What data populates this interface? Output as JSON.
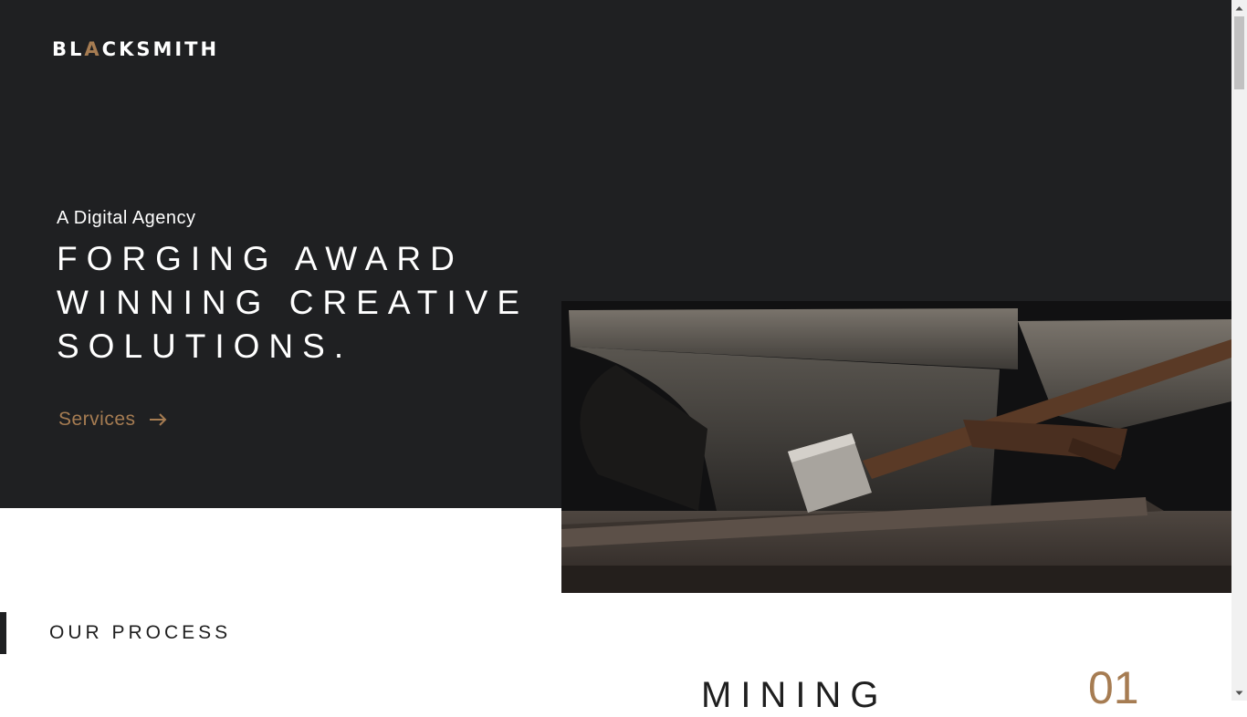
{
  "brand": {
    "logo_text": "BLACKSMITH",
    "accent_color": "#a67c52",
    "dark_color": "#1f2022"
  },
  "header": {
    "menu_icon": "grid-dots-icon"
  },
  "hero": {
    "tagline": "A Digital Agency",
    "headline_lines": [
      "FORGING AWARD",
      "WINNING CREATIVE",
      "SOLUTIONS."
    ],
    "cta_label": "Services",
    "cta_icon": "arrow-right-icon",
    "image_subject": "anvil-and-hammer-image"
  },
  "process": {
    "section_title": "OUR PROCESS",
    "step_title": "MINING",
    "step_number": "01"
  }
}
